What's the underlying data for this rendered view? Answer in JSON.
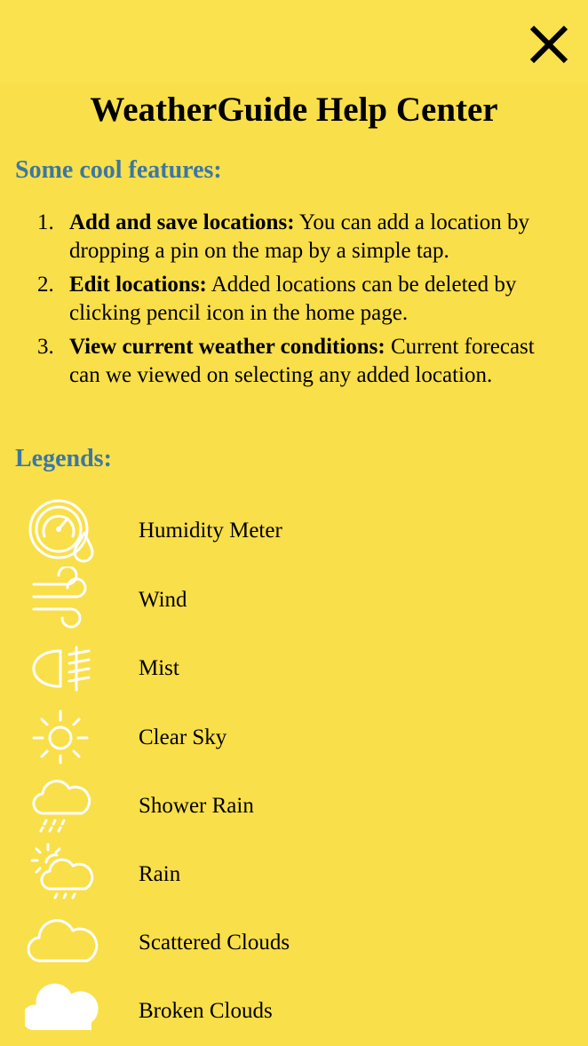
{
  "header": {
    "close_icon": "close-icon"
  },
  "title": "WeatherGuide Help Center",
  "features_heading": "Some cool features:",
  "features": [
    {
      "number": "1.",
      "bold": "Add and save locations:",
      "text": " You can add a location by dropping a pin on the map by a simple tap."
    },
    {
      "number": "2.",
      "bold": "Edit locations:",
      "text": " Added locations can be deleted by clicking pencil icon in the home page."
    },
    {
      "number": "3.",
      "bold": "View current weather conditions:",
      "text": " Current forecast can we viewed on selecting any added location."
    }
  ],
  "legends_heading": "Legends:",
  "legends": [
    {
      "icon": "humidity-meter-icon",
      "label": "Humidity Meter"
    },
    {
      "icon": "wind-icon",
      "label": "Wind"
    },
    {
      "icon": "mist-icon",
      "label": "Mist"
    },
    {
      "icon": "clear-sky-icon",
      "label": "Clear Sky"
    },
    {
      "icon": "shower-rain-icon",
      "label": "Shower Rain"
    },
    {
      "icon": "rain-icon",
      "label": "Rain"
    },
    {
      "icon": "scattered-clouds-icon",
      "label": "Scattered Clouds"
    },
    {
      "icon": "broken-clouds-icon",
      "label": "Broken Clouds"
    }
  ],
  "colors": {
    "background": "#F9DF49",
    "heading_blue": "#3C77A3",
    "icon_white": "#FFFFFF"
  }
}
